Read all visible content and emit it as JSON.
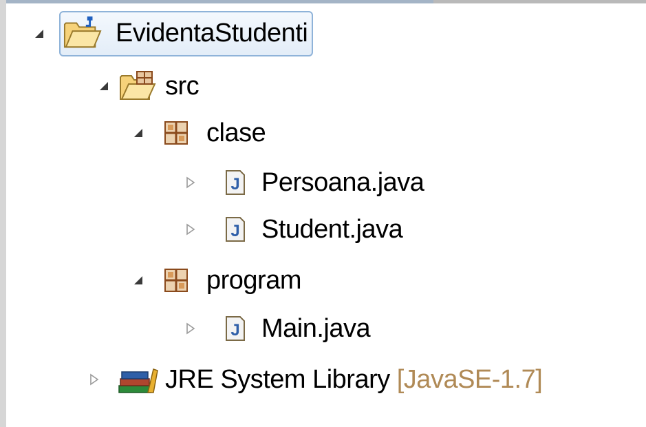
{
  "tree": {
    "project": {
      "label": "EvidentaStudenti",
      "icon": "project-folder-icon",
      "expanded": true
    },
    "src": {
      "label": "src",
      "icon": "source-folder-icon",
      "expanded": true
    },
    "packages": [
      {
        "label": "clase",
        "icon": "package-icon",
        "expanded": true,
        "files": [
          {
            "label": "Persoana.java",
            "icon": "java-file-icon"
          },
          {
            "label": "Student.java",
            "icon": "java-file-icon"
          }
        ]
      },
      {
        "label": "program",
        "icon": "package-icon",
        "expanded": true,
        "files": [
          {
            "label": "Main.java",
            "icon": "java-file-icon"
          }
        ]
      }
    ],
    "library": {
      "label": "JRE System Library",
      "decoration": "[JavaSE-1.7]",
      "icon": "library-icon",
      "expanded": false
    }
  },
  "colors": {
    "selection_border": "#8fb3d9",
    "decoration_text": "#b08a56",
    "package_brown": "#8a4a1c",
    "java_blue": "#2f5fa8"
  }
}
